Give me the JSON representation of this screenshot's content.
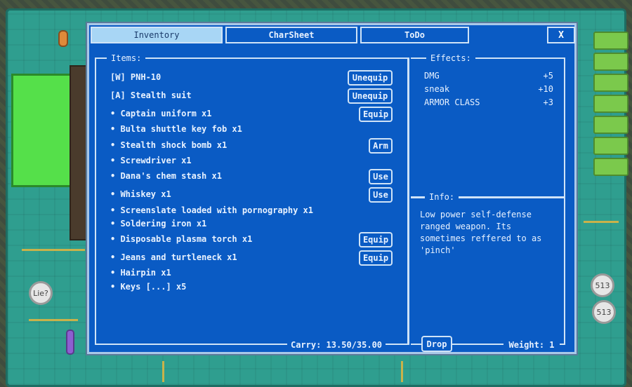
{
  "tabs": [
    {
      "label": "Inventory",
      "active": true
    },
    {
      "label": "CharSheet",
      "active": false
    },
    {
      "label": "ToDo",
      "active": false
    }
  ],
  "close_label": "X",
  "items_header": "Items:",
  "effects_header": "Effects:",
  "info_header": "Info:",
  "items": [
    {
      "label": "[W] PNH-10",
      "action": "Unequip"
    },
    {
      "label": "[A] Stealth suit",
      "action": "Unequip"
    },
    {
      "label": "• Captain uniform x1",
      "action": "Equip"
    },
    {
      "label": "• Bulta shuttle key fob x1",
      "action": null
    },
    {
      "label": "• Stealth shock bomb x1",
      "action": "Arm"
    },
    {
      "label": "• Screwdriver x1",
      "action": null
    },
    {
      "label": "• Dana's chem stash x1",
      "action": "Use"
    },
    {
      "label": "• Whiskey x1",
      "action": "Use"
    },
    {
      "label": "• Screenslate loaded with pornography x1",
      "action": null
    },
    {
      "label": "• Soldering iron x1",
      "action": null
    },
    {
      "label": "• Disposable plasma torch x1",
      "action": "Equip"
    },
    {
      "label": "• Jeans and turtleneck x1",
      "action": "Equip"
    },
    {
      "label": "• Hairpin x1",
      "action": null
    },
    {
      "label": "• Keys [...] x5",
      "action": null
    }
  ],
  "effects": [
    {
      "name": "DMG",
      "value": "+5"
    },
    {
      "name": "sneak",
      "value": "+10"
    },
    {
      "name": "ARMOR CLASS",
      "value": "+3"
    }
  ],
  "info_text": "Low power self-defense ranged weapon. Its sometimes reffered to as 'pinch'",
  "carry_label": "Carry: 13.50/35.00",
  "drop_label": "Drop",
  "weight_label": "Weight: 1",
  "capacitor_labels": [
    "Lie?",
    "513",
    "513"
  ],
  "colors": {
    "panel_bg": "#0a5bc4",
    "border": "#cfe3f7",
    "active_tab": "#a8d6f5",
    "board": "#2f9e8f"
  }
}
